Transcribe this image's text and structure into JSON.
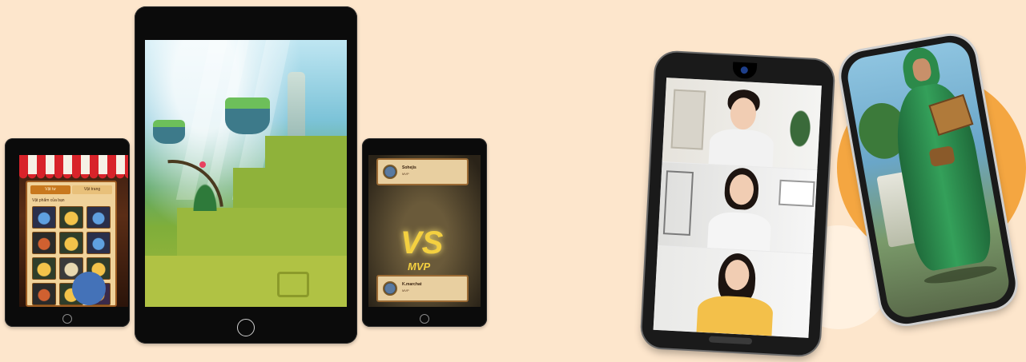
{
  "colors": {
    "background": "#fde6cc",
    "accent_orange": "#f4a641",
    "device_black": "#0b0b0b"
  },
  "left_tablet": {
    "tabs": [
      "Vật tư",
      "Vật trang"
    ],
    "panel_title": "Vật phẩm của bạn",
    "item_icons": [
      "chest-icon",
      "chest-icon",
      "chest-icon",
      "chest-icon",
      "chest-icon",
      "chest-icon",
      "chest-icon",
      "chest-icon",
      "chest-icon",
      "chest-icon",
      "chest-icon",
      "chest-icon"
    ]
  },
  "right_tablet": {
    "top_player": {
      "name": "Sohejis",
      "sub": "MVP"
    },
    "vs_label": "VS",
    "mvp_label": "MVP",
    "bottom_player": {
      "name": "K.marchat",
      "sub": "MVP"
    }
  },
  "icons": {
    "home_button": "home-button-icon",
    "camera": "front-camera-icon",
    "avatar": "player-avatar-icon",
    "touch_indicator": "touch-indicator-icon"
  }
}
